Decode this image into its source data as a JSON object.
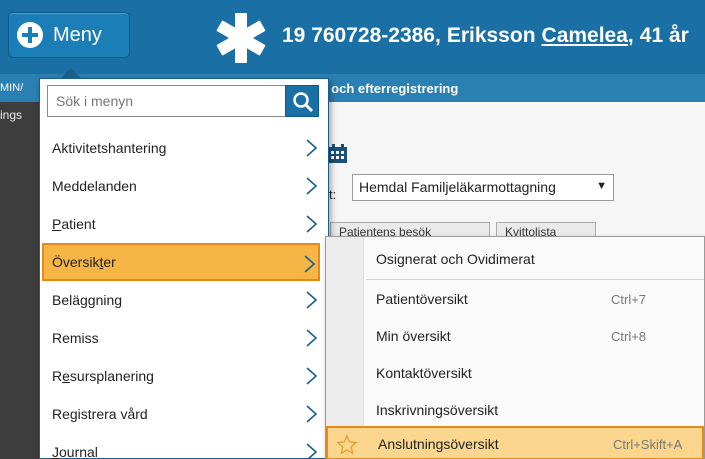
{
  "header": {
    "menu_label": "Meny",
    "personal_number": "19 760728-2386,",
    "surname": "Eriksson",
    "firstname": "Camelea",
    "age": "41 år"
  },
  "subbar": {
    "left_label": "MIN/",
    "title": "kt och efterregistrering"
  },
  "left_panel": {
    "label": "ings"
  },
  "background": {
    "unit_label": "t:",
    "unit_select_value": "Hemdal Familjeläkarmottagning",
    "tab1": "Patientens besök",
    "tab2": "Kvittolista"
  },
  "menu": {
    "search_placeholder": "Sök i menyn",
    "items": [
      {
        "label": "Aktivitetshantering"
      },
      {
        "label": "Meddelanden"
      },
      {
        "label_pre": "",
        "label_ul": "P",
        "label_post": "atient"
      },
      {
        "label_pre": "Översik",
        "label_ul": "t",
        "label_post": "er"
      },
      {
        "label": "Beläggning"
      },
      {
        "label": "Remiss"
      },
      {
        "label_pre": "R",
        "label_ul": "e",
        "label_post": "sursplanering"
      },
      {
        "label": "Registrera vård"
      },
      {
        "label_pre": "",
        "label_ul": "J",
        "label_post": "ournal"
      }
    ]
  },
  "submenu": {
    "items": [
      {
        "label": "Osignerat och Ovidimerat",
        "shortcut": ""
      },
      {
        "label": "Patientöversikt",
        "shortcut": "Ctrl+7"
      },
      {
        "label": "Min översikt",
        "shortcut": "Ctrl+8"
      },
      {
        "label": "Kontaktöversikt",
        "shortcut": ""
      },
      {
        "label": "Inskrivningsöversikt",
        "shortcut": ""
      },
      {
        "label": "Anslutningsöversikt",
        "shortcut": "Ctrl+Skift+A"
      }
    ]
  },
  "colors": {
    "header_blue": "#1a6fa5",
    "highlight_orange": "#f7b546",
    "highlight_border": "#e58a16"
  }
}
